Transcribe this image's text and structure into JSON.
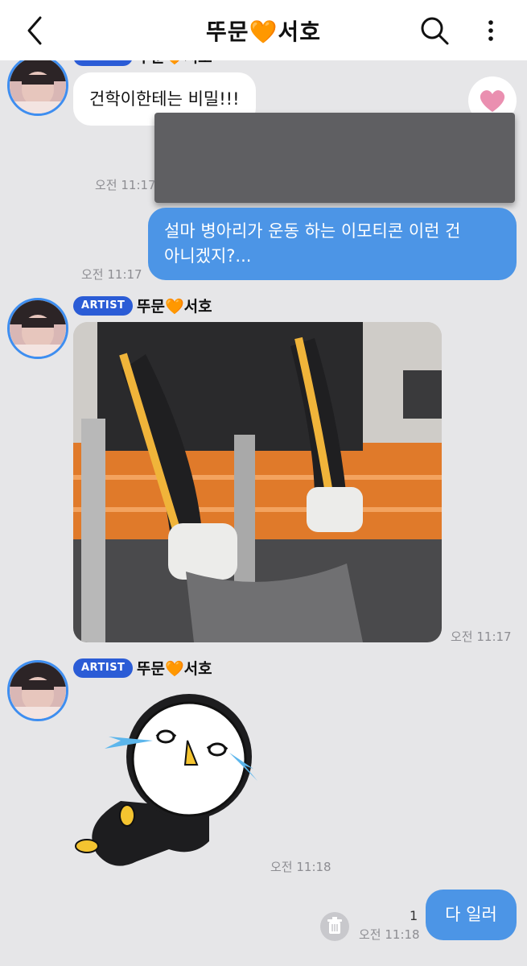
{
  "header": {
    "title": "뚜문🧡서호",
    "back_icon": "back-chevron-icon",
    "search_icon": "search-icon",
    "more_icon": "more-vertical-icon"
  },
  "messages": [
    {
      "sender": "뚜문🧡서호",
      "badge": "ARTIST",
      "text": "건학이한테는 비밀!!!",
      "time": "오전 11:17"
    },
    {
      "type": "outgoing",
      "text_line1": "설마 병아리가 운동 하는 이모티콘 이런 건",
      "text_line2": "아니겠지?...",
      "time": "오전 11:17"
    },
    {
      "sender": "뚜문🧡서호",
      "badge": "ARTIST",
      "type": "photo",
      "time": "오전 11:17"
    },
    {
      "sender": "뚜문🧡서호",
      "badge": "ARTIST",
      "type": "sticker",
      "time": "오전 11:18"
    },
    {
      "type": "outgoing",
      "text": "다 일러",
      "time": "오전 11:18",
      "unread": "1"
    }
  ],
  "colors": {
    "accent_blue": "#4c95e6",
    "badge_blue": "#2b5cd6",
    "background": "#e6e6e8"
  }
}
